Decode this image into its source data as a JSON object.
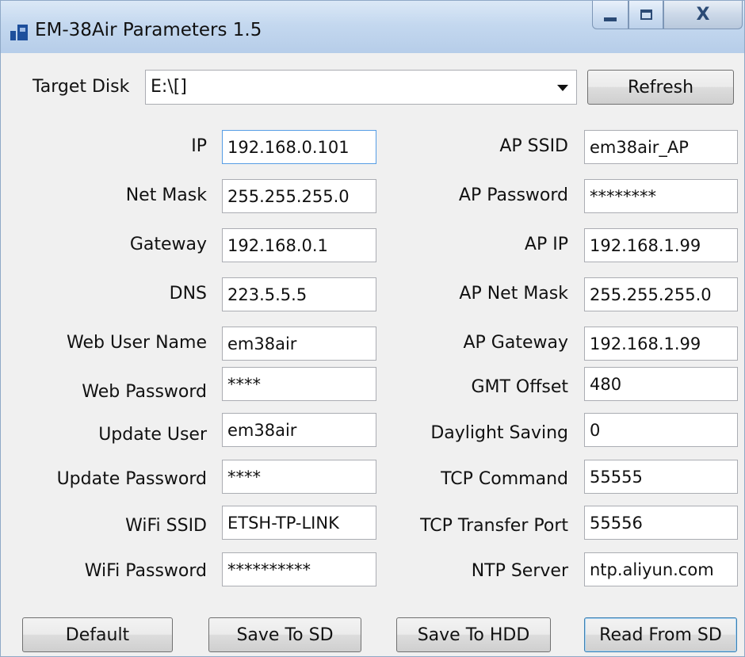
{
  "window": {
    "title": "EM-38Air Parameters 1.5",
    "controls": {
      "minimize": "minimize",
      "maximize": "maximize",
      "close": "X"
    }
  },
  "target_disk": {
    "label": "Target Disk",
    "value": "E:\\[]",
    "refresh_label": "Refresh"
  },
  "left_fields": [
    {
      "label": "IP",
      "value": "192.168.0.101"
    },
    {
      "label": "Net Mask",
      "value": "255.255.255.0"
    },
    {
      "label": "Gateway",
      "value": "192.168.0.1"
    },
    {
      "label": "DNS",
      "value": "223.5.5.5"
    },
    {
      "label": "Web User Name",
      "value": "em38air"
    },
    {
      "label": "Web Password",
      "value": "****"
    },
    {
      "label": "Update User",
      "value": "em38air"
    },
    {
      "label": "Update Password",
      "value": "****"
    },
    {
      "label": "WiFi SSID",
      "value": "ETSH-TP-LINK"
    },
    {
      "label": "WiFi Password",
      "value": "**********"
    }
  ],
  "right_fields": [
    {
      "label": "AP SSID",
      "value": "em38air_AP"
    },
    {
      "label": "AP Password",
      "value": "********"
    },
    {
      "label": "AP IP",
      "value": "192.168.1.99"
    },
    {
      "label": "AP Net Mask",
      "value": "255.255.255.0"
    },
    {
      "label": "AP Gateway",
      "value": "192.168.1.99"
    },
    {
      "label": "GMT Offset",
      "value": "480"
    },
    {
      "label": "Daylight Saving",
      "value": "0"
    },
    {
      "label": "TCP Command",
      "value": "55555"
    },
    {
      "label": "TCP Transfer Port",
      "value": "55556"
    },
    {
      "label": "NTP Server",
      "value": "ntp.aliyun.com"
    }
  ],
  "buttons": {
    "default": "Default",
    "save_sd": "Save To SD",
    "save_hdd": "Save To HDD",
    "read_sd": "Read From SD"
  },
  "colors": {
    "titlebar": "#c4d8ef",
    "window_bg": "#f0f0f0",
    "focus_border": "#569de5"
  }
}
